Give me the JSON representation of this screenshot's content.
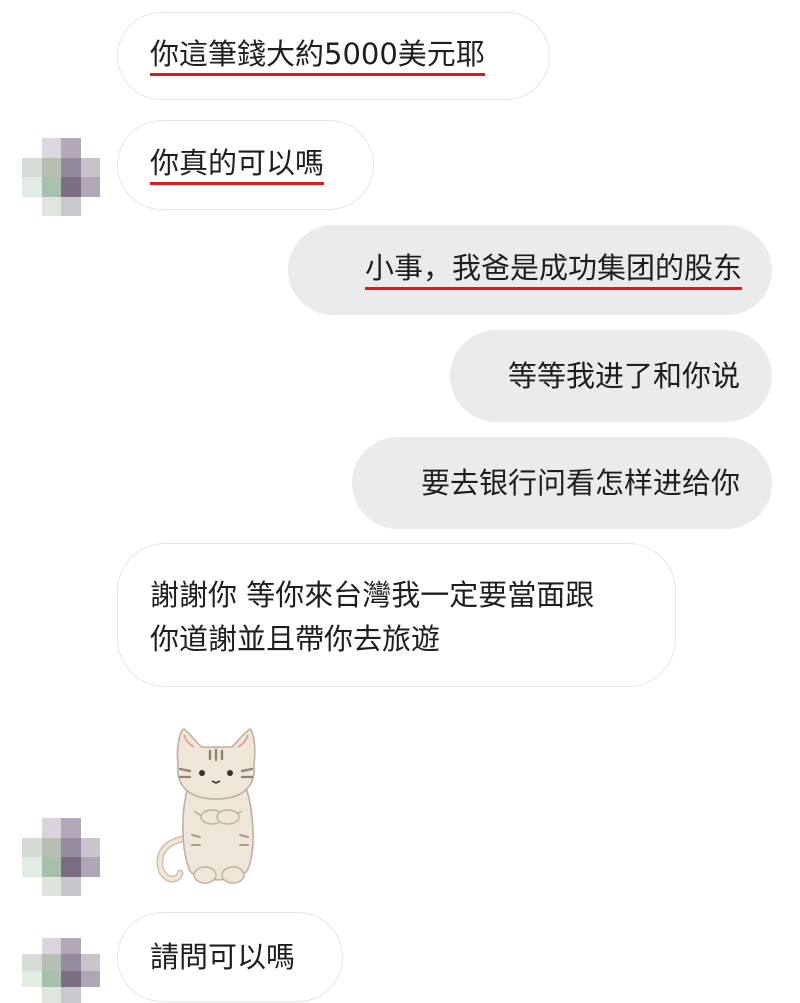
{
  "messages": [
    {
      "text": "你這筆錢大約5000美元耶"
    },
    {
      "text": "你真的可以嗎"
    },
    {
      "text": "小事，我爸是成功集团的股东"
    },
    {
      "text": "等等我进了和你说"
    },
    {
      "text": "要去银行问看怎样进给你"
    },
    {
      "line1": "謝謝你 等你來台灣我一定要當面跟",
      "line2": "你道謝並且帶你去旅遊"
    },
    {
      "sticker": "cat-sticker"
    },
    {
      "text": "請問可以嗎"
    }
  ],
  "colors": {
    "outgoing_bubble": "#ebebeb",
    "incoming_border": "#e6e6e6",
    "underline": "#e01919"
  },
  "icons": {
    "avatar": "blurred-avatar-icon",
    "sticker": "cat-sticker-icon"
  }
}
